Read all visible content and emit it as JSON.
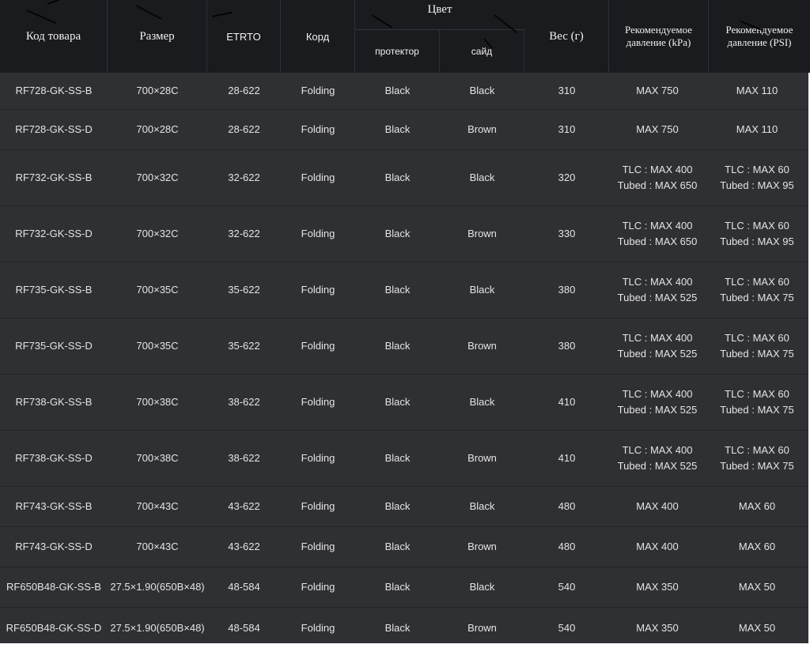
{
  "table": {
    "headers": {
      "code": "Код товара",
      "size": "Размер",
      "etrto": "ETRTO",
      "cord": "Корд",
      "color": "Цвет",
      "color_tread": "протектор",
      "color_side": "сайд",
      "weight": "Вес (г)",
      "pressure_kpa": [
        "Рекомендуемое",
        "давление (kPa)"
      ],
      "pressure_psi": [
        "Рекомендуемое",
        "давление (PSI)"
      ]
    },
    "rows": [
      {
        "code": "RF728-GK-SS-B",
        "size": "700×28C",
        "etrto": "28-622",
        "cord": "Folding",
        "tread": "Black",
        "side": "Black",
        "weight": "310",
        "kpa": [
          "MAX 750"
        ],
        "psi": [
          "MAX 110"
        ]
      },
      {
        "code": "RF728-GK-SS-D",
        "size": "700×28C",
        "etrto": "28-622",
        "cord": "Folding",
        "tread": "Black",
        "side": "Brown",
        "weight": "310",
        "kpa": [
          "MAX 750"
        ],
        "psi": [
          "MAX 110"
        ]
      },
      {
        "code": "RF732-GK-SS-B",
        "size": "700×32C",
        "etrto": "32-622",
        "cord": "Folding",
        "tread": "Black",
        "side": "Black",
        "weight": "320",
        "kpa": [
          "TLC : MAX 400",
          "Tubed : MAX 650"
        ],
        "psi": [
          "TLC : MAX 60",
          "Tubed : MAX 95"
        ]
      },
      {
        "code": "RF732-GK-SS-D",
        "size": "700×32C",
        "etrto": "32-622",
        "cord": "Folding",
        "tread": "Black",
        "side": "Brown",
        "weight": "330",
        "kpa": [
          "TLC : MAX 400",
          "Tubed : MAX 650"
        ],
        "psi": [
          "TLC : MAX 60",
          "Tubed : MAX 95"
        ]
      },
      {
        "code": "RF735-GK-SS-B",
        "size": "700×35C",
        "etrto": "35-622",
        "cord": "Folding",
        "tread": "Black",
        "side": "Black",
        "weight": "380",
        "kpa": [
          "TLC : MAX 400",
          "Tubed : MAX 525"
        ],
        "psi": [
          "TLC : MAX 60",
          "Tubed : MAX 75"
        ]
      },
      {
        "code": "RF735-GK-SS-D",
        "size": "700×35C",
        "etrto": "35-622",
        "cord": "Folding",
        "tread": "Black",
        "side": "Brown",
        "weight": "380",
        "kpa": [
          "TLC : MAX 400",
          "Tubed : MAX 525"
        ],
        "psi": [
          "TLC : MAX 60",
          "Tubed : MAX 75"
        ]
      },
      {
        "code": "RF738-GK-SS-B",
        "size": "700×38C",
        "etrto": "38-622",
        "cord": "Folding",
        "tread": "Black",
        "side": "Black",
        "weight": "410",
        "kpa": [
          "TLC : MAX 400",
          "Tubed : MAX 525"
        ],
        "psi": [
          "TLC : MAX 60",
          "Tubed : MAX 75"
        ]
      },
      {
        "code": "RF738-GK-SS-D",
        "size": "700×38C",
        "etrto": "38-622",
        "cord": "Folding",
        "tread": "Black",
        "side": "Brown",
        "weight": "410",
        "kpa": [
          "TLC : MAX 400",
          "Tubed : MAX 525"
        ],
        "psi": [
          "TLC : MAX 60",
          "Tubed : MAX 75"
        ]
      },
      {
        "code": "RF743-GK-SS-B",
        "size": "700×43C",
        "etrto": "43-622",
        "cord": "Folding",
        "tread": "Black",
        "side": "Black",
        "weight": "480",
        "kpa": [
          "MAX 400"
        ],
        "psi": [
          "MAX 60"
        ]
      },
      {
        "code": "RF743-GK-SS-D",
        "size": "700×43C",
        "etrto": "43-622",
        "cord": "Folding",
        "tread": "Black",
        "side": "Brown",
        "weight": "480",
        "kpa": [
          "MAX 400"
        ],
        "psi": [
          "MAX 60"
        ]
      },
      {
        "code": "RF650B48-GK-SS-B",
        "size": "27.5×1.90(650B×48)",
        "etrto": "48-584",
        "cord": "Folding",
        "tread": "Black",
        "side": "Black",
        "weight": "540",
        "kpa": [
          "MAX 350"
        ],
        "psi": [
          "MAX 50"
        ]
      },
      {
        "code": "RF650B48-GK-SS-D",
        "size": "27.5×1.90(650B×48)",
        "etrto": "48-584",
        "cord": "Folding",
        "tread": "Black",
        "side": "Brown",
        "weight": "540",
        "kpa": [
          "MAX 350"
        ],
        "psi": [
          "MAX 50"
        ]
      }
    ]
  },
  "colors": {
    "header_bg": "#1a1b1f",
    "row_bg": "#2f3033",
    "row_divider": "#242528",
    "text": "#e4e4e4"
  }
}
